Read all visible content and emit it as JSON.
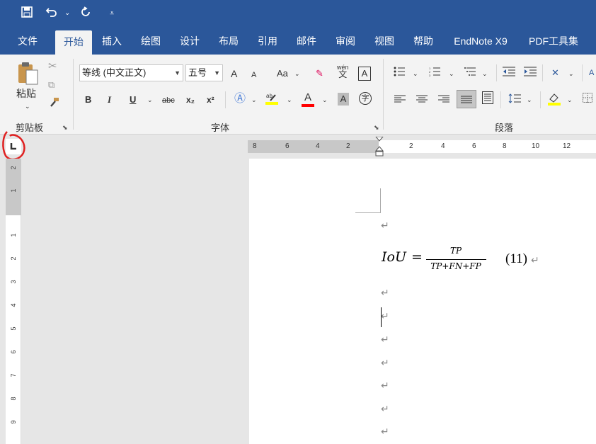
{
  "quick_access": {
    "save": "save-icon",
    "undo": "undo-icon",
    "redo": "redo-icon",
    "customize": "customize-icon"
  },
  "tabs": [
    "文件",
    "开始",
    "插入",
    "绘图",
    "设计",
    "布局",
    "引用",
    "邮件",
    "审阅",
    "视图",
    "帮助",
    "EndNote X9",
    "PDF工具集"
  ],
  "active_tab": "开始",
  "ribbon": {
    "clipboard": {
      "paste_label": "粘贴",
      "group_label": "剪贴板"
    },
    "font": {
      "font_name": "等线 (中文正文)",
      "font_size": "五号",
      "bold": "B",
      "italic": "I",
      "underline": "U",
      "strike": "abc",
      "subscript": "x₂",
      "superscript": "x²",
      "font_color_letter": "A",
      "change_case": "Aa",
      "phonetic_top": "wén",
      "phonetic_bottom": "文",
      "char_border": "A",
      "char_shade": "A",
      "enclose": "字",
      "grow": "A",
      "shrink": "A",
      "group_label": "字体"
    },
    "paragraph": {
      "group_label": "段落"
    }
  },
  "ruler": {
    "horizontal_left": [
      "8",
      "6",
      "4",
      "2"
    ],
    "horizontal_right": [
      "2",
      "4",
      "6",
      "8",
      "10",
      "12"
    ],
    "vertical_top": [
      "2",
      "1"
    ],
    "vertical_main": [
      "1",
      "2",
      "3",
      "4",
      "5",
      "6",
      "7",
      "8",
      "9"
    ]
  },
  "document": {
    "formula_lhs": "IoU",
    "formula_eq": "=",
    "numerator": "TP",
    "denominator": "TP+FN+FP",
    "equation_number": "(11)",
    "paragraph_mark": "↵"
  },
  "colors": {
    "brand": "#2b579a",
    "annotation_circle": "#e02020",
    "highlight": "#ffff00",
    "font_color": "#ff0000"
  }
}
